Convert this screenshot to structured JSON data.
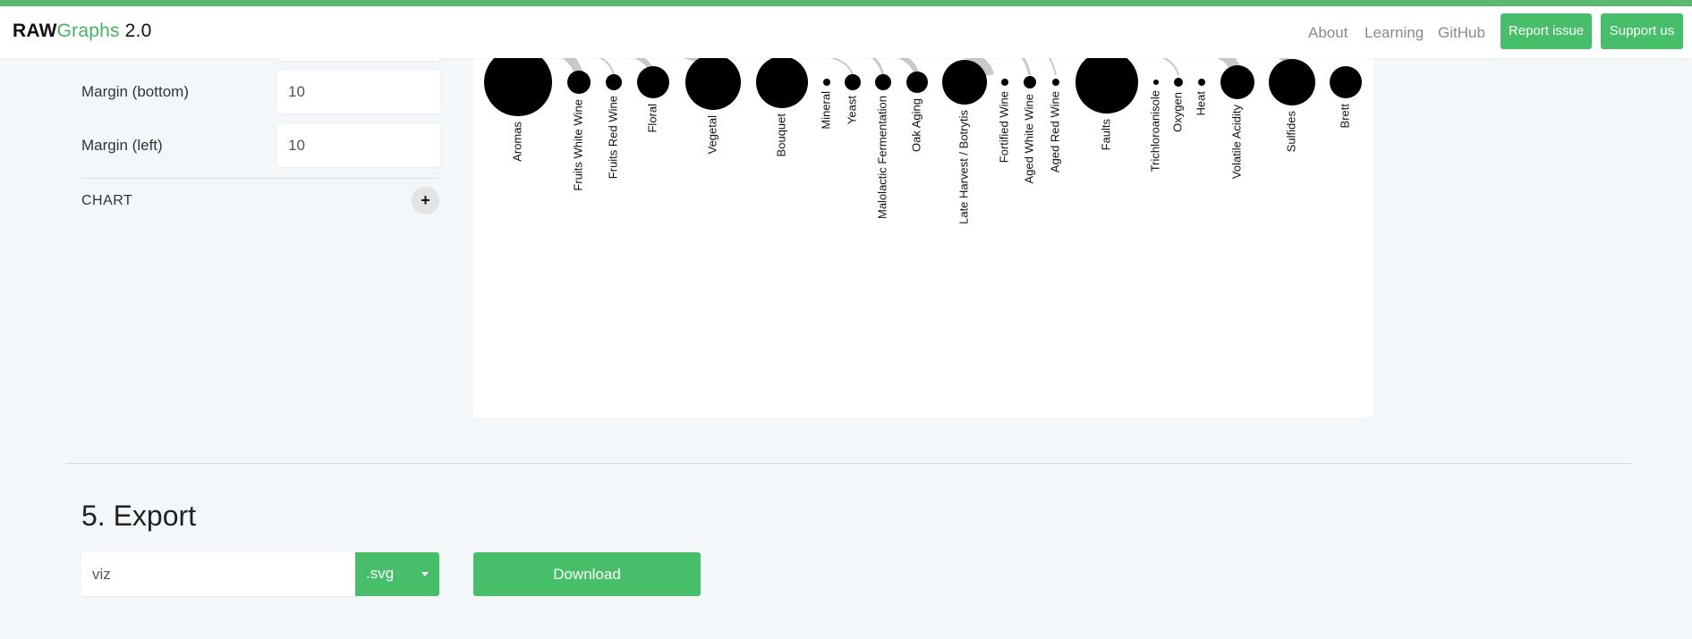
{
  "navbar": {
    "brand_bold": "RAW",
    "brand_green": "Graphs",
    "brand_version": "2.0",
    "links": [
      "About",
      "Learning",
      "GitHub"
    ],
    "report_issue": "Report issue",
    "support_us": "Support us"
  },
  "options": {
    "margin_bottom": {
      "label": "Margin (bottom)",
      "value": "10"
    },
    "margin_left": {
      "label": "Margin (left)",
      "value": "10"
    },
    "section_chart": "CHART",
    "expand_symbol": "+"
  },
  "chart_data": {
    "type": "bubble-labels",
    "nodes": [
      {
        "label": "Aromas",
        "size": 38
      },
      {
        "label": "Fruits White Wine",
        "size": 13
      },
      {
        "label": "Fruits Red Wine",
        "size": 9
      },
      {
        "label": "Floral",
        "size": 18
      },
      {
        "label": "Vegetal",
        "size": 31
      },
      {
        "label": "Bouquet",
        "size": 29
      },
      {
        "label": "Mineral",
        "size": 4
      },
      {
        "label": "Yeast",
        "size": 9
      },
      {
        "label": "Malolactic Fermentation",
        "size": 9
      },
      {
        "label": "Oak Aging",
        "size": 12
      },
      {
        "label": "Late Harvest / Botrytis",
        "size": 25
      },
      {
        "label": "Fortified Wine",
        "size": 4
      },
      {
        "label": "Aged White Wine",
        "size": 7
      },
      {
        "label": "Aged Red Wine",
        "size": 4
      },
      {
        "label": "Faults",
        "size": 35
      },
      {
        "label": "Trichloroanisole",
        "size": 3
      },
      {
        "label": "Oxygen",
        "size": 5
      },
      {
        "label": "Heat",
        "size": 4
      },
      {
        "label": "Volatile Acidity",
        "size": 19
      },
      {
        "label": "Sulfides",
        "size": 26
      },
      {
        "label": "Brett",
        "size": 18
      }
    ]
  },
  "export": {
    "title": "5. Export",
    "filename": "viz",
    "format": ".svg",
    "download": "Download"
  }
}
